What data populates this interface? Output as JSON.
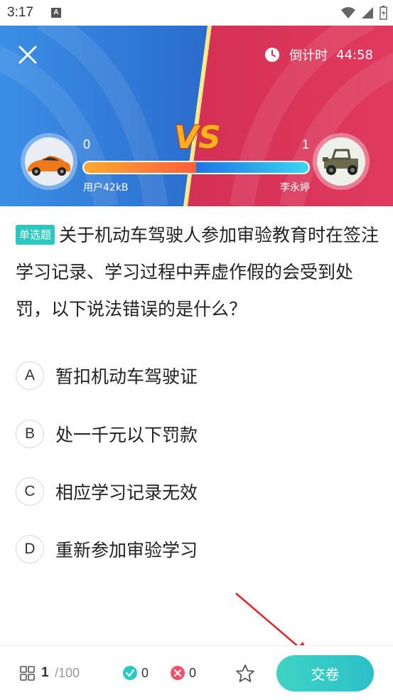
{
  "status_bar": {
    "time": "3:17",
    "notification_icon": "A"
  },
  "header": {
    "countdown_label": "倒计时",
    "countdown_value": "44:58",
    "vs_text": "VS",
    "player_left": {
      "score": "0",
      "name": "用户42kB",
      "avatar_icon": "sports-car"
    },
    "player_right": {
      "score": "1",
      "name": "李永婷",
      "avatar_icon": "jeep"
    },
    "progress_left_fraction": 0.5,
    "colors": {
      "left": "#2f7fd6",
      "right": "#d8345a"
    }
  },
  "question": {
    "tag": "单选题",
    "text": "关于机动车驾驶人参加审验教育时在签注学习记录、学习过程中弄虚作假的会受到处罚，以下说法错误的是什么？"
  },
  "options": [
    {
      "letter": "A",
      "text": "暂扣机动车驾驶证"
    },
    {
      "letter": "B",
      "text": "处一千元以下罚款"
    },
    {
      "letter": "C",
      "text": "相应学习记录无效"
    },
    {
      "letter": "D",
      "text": "重新参加审验学习"
    }
  ],
  "bottom_bar": {
    "current": "1",
    "total": "/100",
    "correct_count": "0",
    "wrong_count": "0",
    "submit_label": "交卷",
    "accent": "#2bc8c1"
  }
}
